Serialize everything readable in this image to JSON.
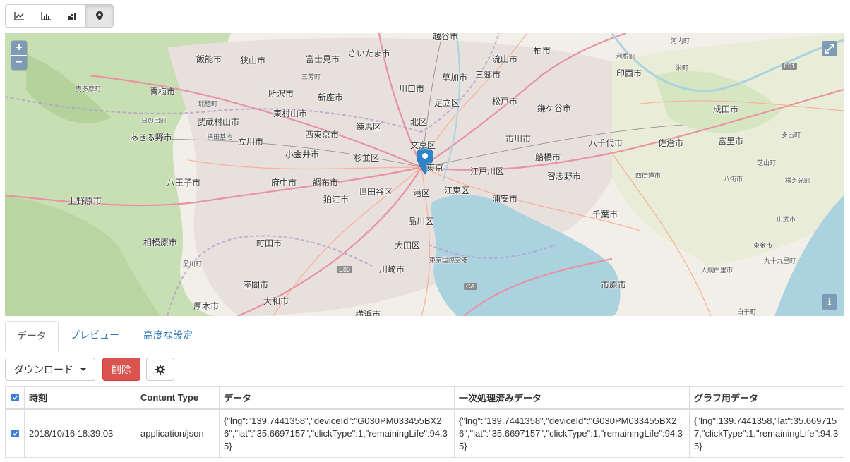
{
  "view_toggle": {
    "icons": [
      "line-chart-icon",
      "bar-chart-icon",
      "stacked-bar-chart-icon",
      "map-marker-icon"
    ],
    "active_index": 3
  },
  "map": {
    "zoom_in": "+",
    "zoom_out": "−",
    "info": "i",
    "labels": [
      "越谷市",
      "さいたま市",
      "飯能市",
      "狭山市",
      "富士見市",
      "三芳町",
      "流山市",
      "柏市",
      "河内町",
      "利根町",
      "草加市",
      "三郷市",
      "印西市",
      "栄町",
      "奥多摩町",
      "青梅市",
      "所沢市",
      "新座市",
      "川口市",
      "瑞穂町",
      "足立区",
      "松戸市",
      "鎌ケ谷市",
      "成田市",
      "日の出町",
      "武蔵村山市",
      "東村山市",
      "北区",
      "あきる野市",
      "横田基地",
      "立川市",
      "西東京市",
      "練馬区",
      "文京区",
      "市川市",
      "八千代市",
      "佐倉市",
      "富里市",
      "多古町",
      "小金井市",
      "杉並区",
      "東京",
      "江戸川区",
      "船橋市",
      "習志野市",
      "四街道市",
      "芝山町",
      "八王子市",
      "府中市",
      "調布市",
      "世田谷区",
      "港区",
      "江東区",
      "浦安市",
      "八街市",
      "横芝光町",
      "上野原市",
      "狛江市",
      "千葉市",
      "山武市",
      "品川区",
      "相模原市",
      "町田市",
      "大田区",
      "東京国際空港",
      "東金市",
      "愛川町",
      "川崎市",
      "九十九里町",
      "大網白里市",
      "座間市",
      "市原市",
      "厚木市",
      "大和市",
      "白子町",
      "横浜市"
    ],
    "roads": [
      "E51",
      "E83",
      "CA"
    ]
  },
  "tabs": [
    {
      "label": "データ",
      "active": true
    },
    {
      "label": "プレビュー",
      "active": false
    },
    {
      "label": "高度な設定",
      "active": false
    }
  ],
  "toolbar": {
    "download_label": "ダウンロード",
    "delete_label": "削除",
    "settings_icon": "gear-icon"
  },
  "table": {
    "headers": [
      "時刻",
      "Content Type",
      "データ",
      "一次処理済みデータ",
      "グラフ用データ"
    ],
    "header_checkbox_checked": true,
    "rows": [
      {
        "checked": true,
        "time": "2018/10/16 18:39:03",
        "content_type": "application/json",
        "data": "{\"lng\":\"139.7441358\",\"deviceId\":\"G030PM033455BX26\",\"lat\":\"35.6697157\",\"clickType\":1,\"remainingLife\":94.35}",
        "processed": "{\"lng\":\"139.7441358\",\"deviceId\":\"G030PM033455BX26\",\"lat\":\"35.6697157\",\"clickType\":1,\"remainingLife\":94.35}",
        "graph": "{\"lng\":139.7441358,\"lat\":35.6697157,\"clickType\":1,\"remainingLife\":94.35}"
      }
    ]
  },
  "colors": {
    "map_bg": "#f2efe9",
    "water": "#aad3df",
    "forest": "#c8dfb4",
    "urban": "#e8e0dc",
    "motorway": "#e892a2",
    "primary_road": "#f9b29c",
    "control": "#7e9bb5",
    "danger": "#d9534f",
    "link": "#337ab7",
    "checkbox": "#3b7ddd"
  }
}
